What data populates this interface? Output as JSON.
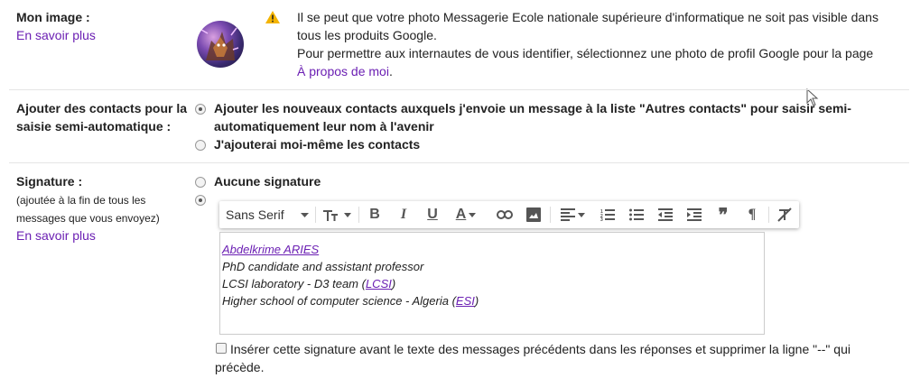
{
  "image": {
    "label": "Mon image :",
    "learn_more": "En savoir plus",
    "warning_line1": "Il se peut que votre photo Messagerie Ecole nationale supérieure d'informatique ne soit pas visible dans",
    "warning_line2": "tous les produits Google.",
    "warning_line3": "Pour permettre aux internautes de vous identifier, sélectionnez une photo de profil Google pour la page",
    "about_link": "À propos de moi",
    "about_suffix": "."
  },
  "contacts": {
    "label_line1": "Ajouter des contacts pour la",
    "label_line2": "saisie semi-automatique :",
    "option1_line1": "Ajouter les nouveaux contacts auxquels j'envoie un message à la liste \"Autres contacts\" pour saisir semi-",
    "option1_line2": "automatiquement leur nom à l'avenir",
    "option2": "J'ajouterai moi-même les contacts"
  },
  "signature": {
    "label": "Signature :",
    "hint_line1": "(ajoutée à la fin de tous les",
    "hint_line2": "messages que vous envoyez)",
    "learn_more": "En savoir plus",
    "none_option": "Aucune signature",
    "font_select": "Sans Serif",
    "lines": {
      "name": "Abdelkrime ARIES",
      "title": "PhD candidate and assistant professor",
      "lab_prefix": "LCSI laboratory - D3 team (",
      "lab_link": "LCSI",
      "lab_suffix": ")",
      "school_prefix": "Higher school of computer science - Algeria (",
      "school_link": "ESI",
      "school_suffix": ")"
    },
    "insert_before_line1": "Insérer cette signature avant le texte des messages précédents dans les réponses et supprimer la ligne \"--\" qui",
    "insert_before_line2": "précède."
  },
  "colors": {
    "link": "#6b1fb3",
    "warning": "#f4b400"
  }
}
